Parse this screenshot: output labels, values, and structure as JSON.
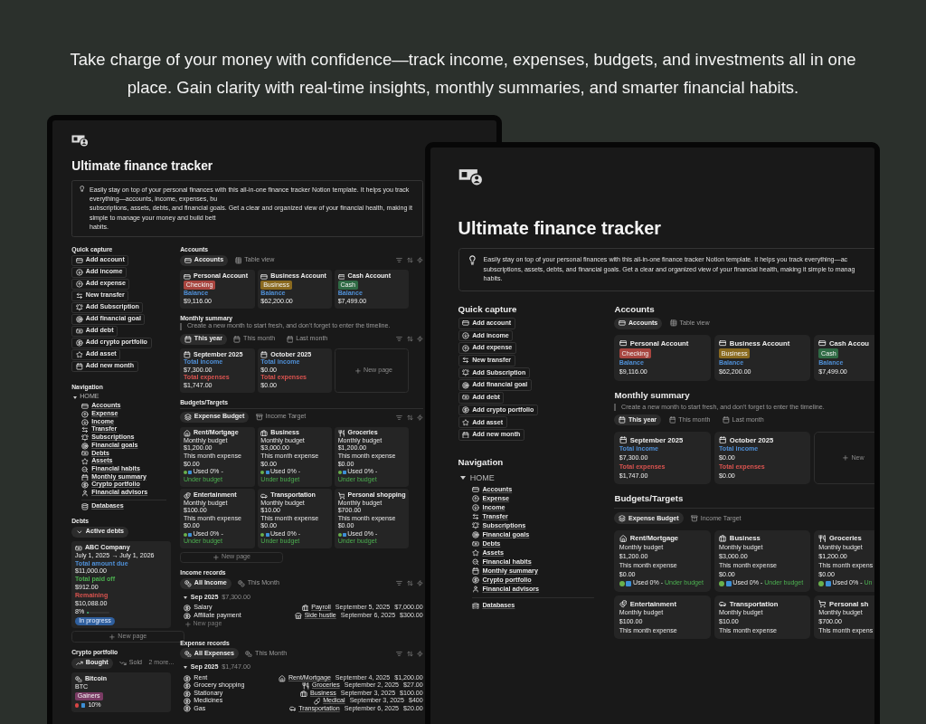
{
  "headline": "Take charge of your money with confidence—track income, expenses, budgets, and investments all in one place. Gain clarity with real-time insights, monthly summaries, and smarter financial habits.",
  "screens": [
    {
      "title": "Ultimate finance tracker",
      "callout": [
        "Easily stay on top of your personal finances with this all-in-one finance tracker Notion template. It helps you track everything—accounts, income, expenses, bu",
        "subscriptions, assets, debts, and financial goals. Get a clear and organized view of your financial health, making it simple to manage your money and build bett",
        "habits."
      ],
      "quick_capture": {
        "heading": "Quick capture",
        "buttons": [
          "Add account",
          "Add income",
          "Add expense",
          "New transfer",
          "Add Subscription",
          "Add financial goal",
          "Add debt",
          "Add crypto portfolio",
          "Add asset",
          "Add new month"
        ]
      },
      "navigation": {
        "heading": "Navigation",
        "group": {
          "label": "HOME",
          "expanded": true,
          "children": [
            "Accounts",
            "Expense",
            "Income",
            "Transfer",
            "Subscriptions",
            "Financial goals",
            "Debts",
            "Assets",
            "Financial habits",
            "Monthly summary",
            "Crypto portfolio",
            "Financial advisors"
          ]
        },
        "databases": "Databases"
      },
      "debts": {
        "heading": "Debts",
        "views": [
          {
            "label": "Active debts",
            "selected": true
          }
        ],
        "card": {
          "name": "ABC Company",
          "dates": "July 1, 2025 → July 1, 2026",
          "due_label": "Total amount due",
          "due": "$11,000.00",
          "paid_label": "Total paid off",
          "paid": "$912.00",
          "remaining_label": "Remaining",
          "remaining": "$10,088.00",
          "percent": "8%",
          "level": 0.08,
          "status": "In progress"
        },
        "new_page": "New page"
      },
      "crypto": {
        "heading": "Crypto portfolio",
        "views": [
          {
            "label": "Bought",
            "selected": true
          },
          {
            "label": "Sold",
            "selected": false
          }
        ],
        "more": "2 more...",
        "card": {
          "name": "Bitcoin",
          "symbol": "BTC",
          "tag": "Gainers",
          "change": "10%"
        }
      },
      "accounts": {
        "heading": "Accounts",
        "views": [
          {
            "label": "Accounts",
            "selected": true
          },
          {
            "label": "Table view",
            "selected": false
          }
        ],
        "cards": [
          {
            "name": "Personal  Account",
            "tag": "Checking",
            "color": "#a8453f",
            "label": "Balance",
            "value": "$9,116.00"
          },
          {
            "name": "Business Account",
            "tag": "Business",
            "color": "#8a6a1f",
            "label": "Balance",
            "value": "$62,200.00"
          },
          {
            "name": "Cash Account",
            "tag": "Cash",
            "color": "#2f6b45",
            "label": "Balance",
            "value": "$7,499.00"
          }
        ]
      },
      "monthly_summary": {
        "heading": "Monthly summary",
        "note": "Create a new month to start fresh, and don't forget to enter the timeline.",
        "views": [
          {
            "label": "This year",
            "selected": true
          },
          {
            "label": "This month",
            "selected": false
          },
          {
            "label": "Last month",
            "selected": false
          }
        ],
        "cards": [
          {
            "name": "September 2025",
            "income_label": "Total income",
            "income": "$7,300.00",
            "expense_label": "Total expenses",
            "expense": "$1,747.00"
          },
          {
            "name": "October 2025",
            "income_label": "Total income",
            "income": "$0.00",
            "expense_label": "Total expenses",
            "expense": "$0.00"
          }
        ],
        "new_page": "New page"
      },
      "budgets": {
        "heading": "Budgets/Targets",
        "views": [
          {
            "label": "Expense Budget",
            "selected": true
          },
          {
            "label": "Income Target",
            "selected": false
          }
        ],
        "cards": [
          {
            "name": "Rent/Mortgage",
            "budget_label": "Monthly budget",
            "budget": "$1,200.00",
            "expense_label": "This month expense",
            "expense": "$0.00",
            "usage": "Used 0% -",
            "status": "Under budget"
          },
          {
            "name": "Business",
            "budget_label": "Monthly budget",
            "budget": "$3,000.00",
            "expense_label": "This month expense",
            "expense": "$0.00",
            "usage": "Used 0% -",
            "status": "Under budget"
          },
          {
            "name": "Groceries",
            "budget_label": "Monthly budget",
            "budget": "$1,200.00",
            "expense_label": "This month expense",
            "expense": "$0.00",
            "usage": "Used 0% -",
            "status": "Under budget"
          },
          {
            "name": "Entertainment",
            "budget_label": "Monthly budget",
            "budget": "$100.00",
            "expense_label": "This month expense",
            "expense": "$0.00",
            "usage": "Used 0% -",
            "status": "Under budget"
          },
          {
            "name": "Transportation",
            "budget_label": "Monthly budget",
            "budget": "$10.00",
            "expense_label": "This month expense",
            "expense": "$0.00",
            "usage": "Used 0% -",
            "status": "Under budget"
          },
          {
            "name": "Personal shopping",
            "budget_label": "Monthly budget",
            "budget": "$700.00",
            "expense_label": "This month expense",
            "expense": "$0.00",
            "usage": "Used 0% -",
            "status": "Under budget"
          }
        ],
        "new_page": "New page"
      },
      "income_records": {
        "heading": "Income records",
        "views": [
          {
            "label": "All Income",
            "selected": true
          },
          {
            "label": "This Month",
            "selected": false
          }
        ],
        "group": {
          "label": "Sep 2025",
          "total": "$7,300.00",
          "expanded": true
        },
        "rows": [
          {
            "name": "Salary",
            "category": "Payroll",
            "date": "September 5, 2025",
            "amount": "$7,000.00"
          },
          {
            "name": "Affiliate payment",
            "category": "Side hustle",
            "date": "September 6, 2025",
            "amount": "$300.00"
          }
        ],
        "new_page": "New page"
      },
      "expense_records": {
        "heading": "Expense records",
        "views": [
          {
            "label": "All Expenses",
            "selected": true
          },
          {
            "label": "This Month",
            "selected": false
          }
        ],
        "group": {
          "label": "Sep 2025",
          "total": "$1,747.00",
          "expanded": true
        },
        "rows": [
          {
            "name": "Rent",
            "category": "Rent/Mortgage",
            "date": "September 4, 2025",
            "amount": "$1,200.00"
          },
          {
            "name": "Grocery shopping",
            "category": "Groceries",
            "date": "September 2, 2025",
            "amount": "$27.00"
          },
          {
            "name": "Stationary",
            "category": "Business",
            "date": "September 3, 2025",
            "amount": "$100.00"
          },
          {
            "name": "Medicines",
            "category": "Medical",
            "date": "September 3, 2025",
            "amount": "$400"
          },
          {
            "name": "Gas",
            "category": "Transportation",
            "date": "September 6, 2025",
            "amount": "$20.00"
          }
        ]
      }
    },
    {
      "title": "Ultimate finance tracker",
      "callout": [
        "Easily stay on top of your personal finances with this all-in-one finance tracker Notion template. It helps you track everything—ac",
        "subscriptions, assets, debts, and financial goals. Get a clear and organized view of your financial health, making it simple to manag",
        "habits."
      ],
      "quick_capture": {
        "heading": "Quick capture",
        "buttons": [
          "Add account",
          "Add income",
          "Add expense",
          "New transfer",
          "Add Subscription",
          "Add financial goal",
          "Add debt",
          "Add crypto portfolio",
          "Add asset",
          "Add new month"
        ]
      },
      "navigation": {
        "heading": "Navigation",
        "group": {
          "label": "HOME",
          "expanded": true,
          "children": [
            "Accounts",
            "Expense",
            "Income",
            "Transfer",
            "Subscriptions",
            "Financial goals",
            "Debts",
            "Assets",
            "Financial habits",
            "Monthly summary",
            "Crypto portfolio",
            "Financial advisors"
          ]
        },
        "databases": "Databases"
      },
      "accounts": {
        "heading": "Accounts",
        "views": [
          {
            "label": "Accounts",
            "selected": true
          },
          {
            "label": "Table view",
            "selected": false
          }
        ],
        "cards": [
          {
            "name": "Personal  Account",
            "tag": "Checking",
            "color": "#a8453f",
            "label": "Balance",
            "value": "$9,116.00"
          },
          {
            "name": "Business Account",
            "tag": "Business",
            "color": "#8a6a1f",
            "label": "Balance",
            "value": "$62,200.00"
          },
          {
            "name": "Cash Accou",
            "tag": "Cash",
            "color": "#2f6b45",
            "label": "Balance",
            "value": "$7,499.00"
          }
        ]
      },
      "monthly_summary": {
        "heading": "Monthly summary",
        "note": "Create a new month to start fresh, and don't forget to enter the timeline.",
        "views": [
          {
            "label": "This year",
            "selected": true
          },
          {
            "label": "This month",
            "selected": false
          },
          {
            "label": "Last month",
            "selected": false
          }
        ],
        "cards": [
          {
            "name": "September 2025",
            "income_label": "Total income",
            "income": "$7,300.00",
            "expense_label": "Total expenses",
            "expense": "$1,747.00"
          },
          {
            "name": "October 2025",
            "income_label": "Total income",
            "income": "$0.00",
            "expense_label": "Total expenses",
            "expense": "$0.00"
          }
        ],
        "new_page": "New"
      },
      "budgets": {
        "heading": "Budgets/Targets",
        "views": [
          {
            "label": "Expense Budget",
            "selected": true
          },
          {
            "label": "Income Target",
            "selected": false
          }
        ],
        "cards": [
          {
            "name": "Rent/Mortgage",
            "budget_label": "Monthly budget",
            "budget": "$1,200.00",
            "expense_label": "This month expense",
            "expense": "$0.00",
            "usage": "Used 0% -",
            "status": "Under budget"
          },
          {
            "name": "Business",
            "budget_label": "Monthly budget",
            "budget": "$3,000.00",
            "expense_label": "This month expense",
            "expense": "$0.00",
            "usage": "Used 0% -",
            "status": "Under budget"
          },
          {
            "name": "Groceries",
            "budget_label": "Monthly budget",
            "budget": "$1,200.00",
            "expense_label": "This month expens",
            "expense": "$0.00",
            "usage": "Used 0% -",
            "status": "Un"
          },
          {
            "name": "Entertainment",
            "budget_label": "Monthly budget",
            "budget": "$100.00",
            "expense_label": "This month expense"
          },
          {
            "name": "Transportation",
            "budget_label": "Monthly budget",
            "budget": "$10.00",
            "expense_label": "This month expense"
          },
          {
            "name": "Personal sh",
            "budget_label": "Monthly budget",
            "budget": "$700.00",
            "expense_label": "This month expens"
          }
        ]
      }
    }
  ]
}
